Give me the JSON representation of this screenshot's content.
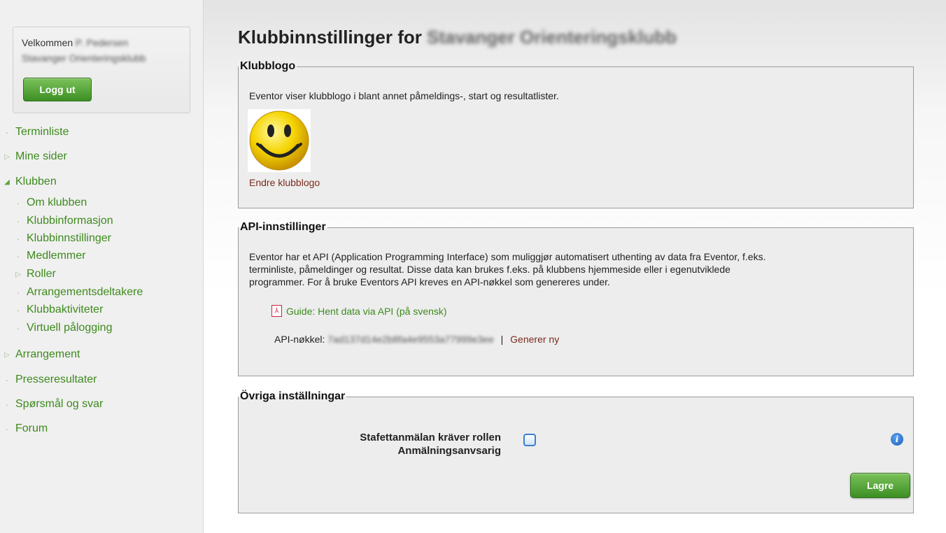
{
  "sidebar": {
    "welcome_prefix": "Velkommen",
    "welcome_name": "P. Pedersen",
    "club_name": "Stavanger Orienteringsklubb",
    "logout_label": "Logg ut",
    "nav": [
      {
        "label": "Terminliste",
        "icon": "bullet"
      },
      {
        "label": "Mine sider",
        "icon": "triangle-right"
      },
      {
        "label": "Klubben",
        "icon": "triangle-open"
      },
      {
        "label": "Om klubben",
        "icon": "bullet"
      },
      {
        "label": "Klubbinformasjon",
        "icon": "bullet"
      },
      {
        "label": "Klubbinnstillinger",
        "icon": "bullet"
      },
      {
        "label": "Medlemmer",
        "icon": "bullet"
      },
      {
        "label": "Roller",
        "icon": "triangle-right"
      },
      {
        "label": "Arrangementsdeltakere",
        "icon": "bullet"
      },
      {
        "label": "Klubbaktiviteter",
        "icon": "bullet"
      },
      {
        "label": "Virtuell pålogging",
        "icon": "bullet"
      },
      {
        "label": "Arrangement",
        "icon": "triangle-right"
      },
      {
        "label": "Presseresultater",
        "icon": "bullet"
      },
      {
        "label": "Spørsmål og svar",
        "icon": "bullet"
      },
      {
        "label": "Forum",
        "icon": "bullet"
      }
    ]
  },
  "main": {
    "title_prefix": "Klubbinnstillinger for",
    "title_club": "Stavanger Orienteringsklubb",
    "logo_panel": {
      "legend": "Klubblogo",
      "description": "Eventor viser klubblogo i blant annet påmeldings-, start og resultatlister.",
      "change_link": "Endre klubblogo"
    },
    "api_panel": {
      "legend": "API-innstillinger",
      "description_line1": "Eventor har et API (Application Programming Interface) som muliggjør automatisert uthenting av data fra Eventor, f.eks.",
      "description_line2": "terminliste, påmeldinger og resultat. Disse data kan brukes f.eks. på klubbens hjemmeside eller i egenutviklede",
      "description_line3": "programmer. For å bruke Eventors API kreves en API-nøkkel som genereres under.",
      "guide_link": "Guide: Hent data via API (på svensk)",
      "key_label": "API-nøkkel:",
      "key_value": "7ad137d14e2b8fa4e9553a77999e3ee",
      "separator": "|",
      "generate_link": "Generer ny"
    },
    "other_panel": {
      "legend": "Övriga inställningar",
      "setting_label_line1": "Stafettanmälan kräver rollen",
      "setting_label_line2": "Anmälningsanvsarig",
      "save_label": "Lagre"
    }
  },
  "colors": {
    "link_green": "#3d8a1d",
    "link_brown": "#7a2b1e",
    "button_green": "#4c9a2e"
  }
}
